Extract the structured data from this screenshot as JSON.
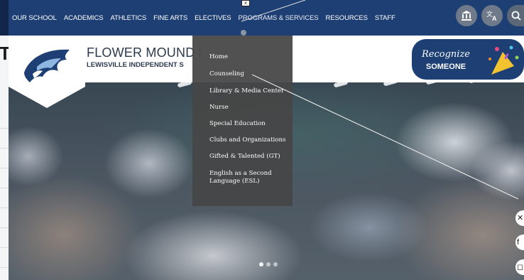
{
  "nav": {
    "items": [
      {
        "label": "OUR SCHOOL"
      },
      {
        "label": "ACADEMICS"
      },
      {
        "label": "ATHLETICS"
      },
      {
        "label": "FINE ARTS"
      },
      {
        "label": "ELECTIVES"
      },
      {
        "label": "PROGRAMS & SERVICES"
      },
      {
        "label": "RESOURCES"
      },
      {
        "label": "STAFF"
      }
    ],
    "icons": [
      "district-building-icon",
      "translate-icon",
      "search-icon"
    ]
  },
  "header": {
    "school_name": "FLOWER MOUND HI",
    "district_name": "LEWISVILLE INDEPENDENT S",
    "recognize_line1": "Recognize",
    "recognize_line2": "SOMEONE"
  },
  "left_strip": {
    "cap_letter": "T"
  },
  "dropdown": {
    "items": [
      {
        "label": "Home"
      },
      {
        "label": "Counseling"
      },
      {
        "label": "Library & Media Center"
      },
      {
        "label": "Nurse"
      },
      {
        "label": "Special Education"
      },
      {
        "label": "Clubs and Organizations"
      },
      {
        "label": "Gifted & Talented (GT)"
      },
      {
        "label": "English as a Second Language (ESL)"
      }
    ]
  },
  "colors": {
    "nav_bg": "#1d3f73",
    "dropdown_bg": "#464646",
    "text_dark": "#2b3a4e",
    "recognize_bg": "#1d3f73"
  }
}
